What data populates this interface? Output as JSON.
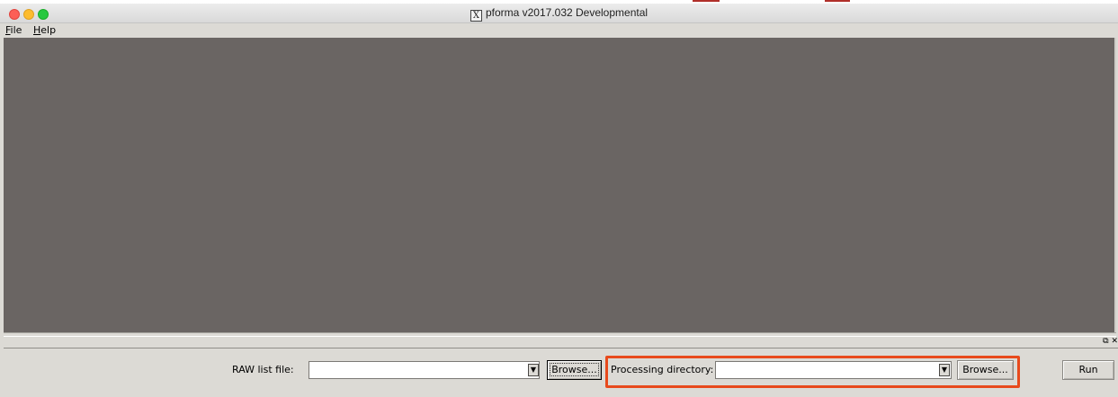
{
  "window": {
    "title": "pforma v2017.032 Developmental",
    "title_icon": "x11-icon"
  },
  "menu": {
    "items": [
      {
        "label": "File",
        "mnemonic": "F",
        "rest": "ile"
      },
      {
        "label": "Help",
        "mnemonic": "H",
        "rest": "elp"
      }
    ]
  },
  "dock": {
    "icons": "⧉ ✕"
  },
  "controls": {
    "raw_list_label": "RAW list file:",
    "raw_list_value": "",
    "raw_browse_label": "Browse...",
    "processing_dir_label": "Processing directory:",
    "processing_dir_value": "",
    "processing_browse_label": "Browse...",
    "run_label": "Run",
    "combo_arrow_glyph": "▼"
  },
  "colors": {
    "canvas": "#6a6563",
    "highlight": "#e84a1c",
    "panel": "#dcdad5"
  }
}
